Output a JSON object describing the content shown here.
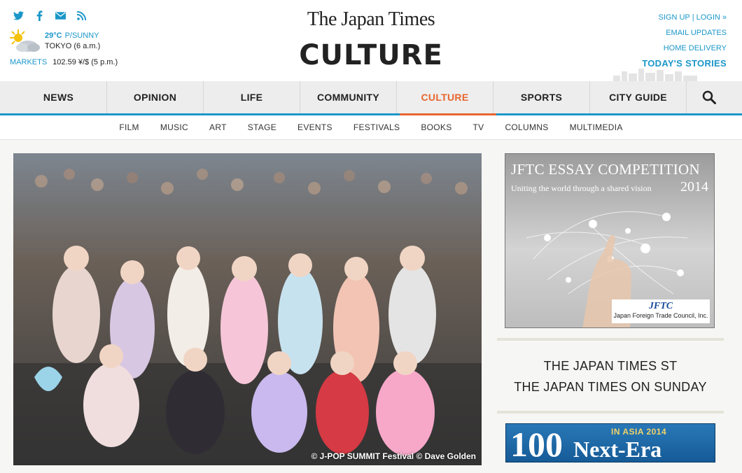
{
  "header": {
    "masthead": "The Japan Times",
    "section_title": "CULTURE",
    "weather": {
      "temp": "29°C",
      "condition": "P/SUNNY",
      "location": "TOKYO (6 a.m.)"
    },
    "markets": {
      "label": "MARKETS",
      "value": "102.59 ¥/$ (5 p.m.)"
    },
    "account": {
      "signup": "SIGN UP",
      "separator": "|",
      "login": "LOGIN »",
      "email_updates": "EMAIL UPDATES",
      "home_delivery": "HOME DELIVERY",
      "todays_stories": "TODAY'S STORIES"
    }
  },
  "social_icons": [
    "twitter-icon",
    "facebook-icon",
    "email-icon",
    "rss-icon"
  ],
  "main_nav": {
    "items": [
      "NEWS",
      "OPINION",
      "LIFE",
      "COMMUNITY",
      "CULTURE",
      "SPORTS",
      "CITY GUIDE"
    ],
    "active": "CULTURE"
  },
  "sub_nav": [
    "FILM",
    "MUSIC",
    "ART",
    "STAGE",
    "EVENTS",
    "FESTIVALS",
    "BOOKS",
    "TV",
    "COLUMNS",
    "MULTIMEDIA"
  ],
  "hero": {
    "credit": "© J-POP SUMMIT Festival © Dave Golden"
  },
  "ads": {
    "jftc": {
      "title": "JFTC ESSAY COMPETITION",
      "subtitle": "Uniting the world through a shared vision",
      "year": "2014",
      "logo": "JFTC",
      "org": "Japan Foreign Trade Council, Inc."
    },
    "ceo": {
      "in_asia": "IN ASIA 2014",
      "number": "100",
      "text": "Next-Era CEOs"
    }
  },
  "sidebar_links": [
    "THE JAPAN TIMES ST",
    "THE JAPAN TIMES ON SUNDAY"
  ],
  "colors": {
    "accent": "#1b97c9",
    "active": "#e8652e",
    "nav_bg": "#ededed"
  }
}
